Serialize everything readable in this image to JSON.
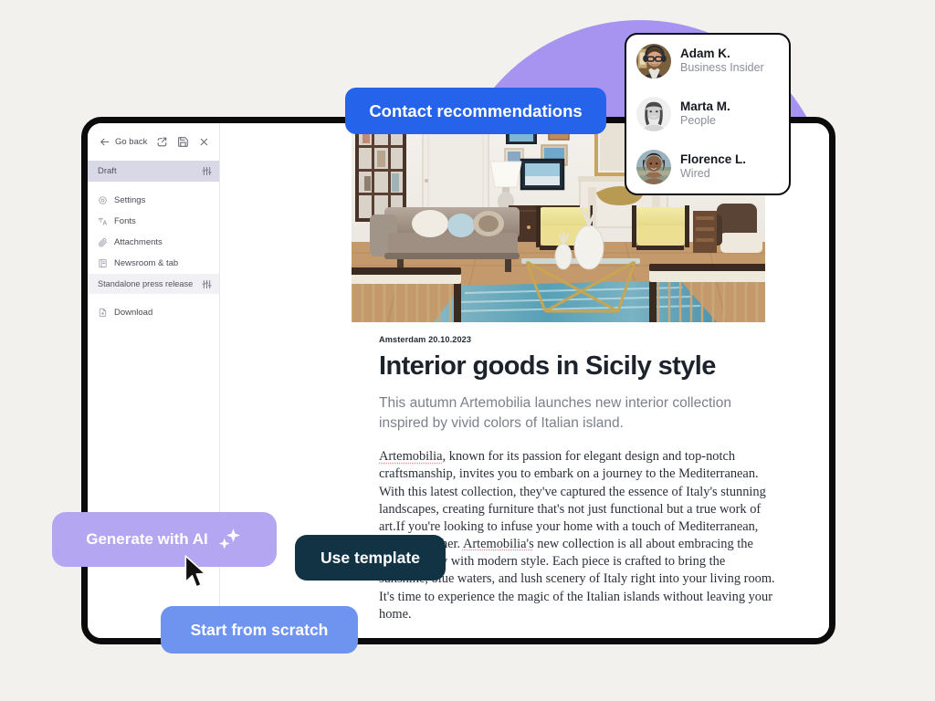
{
  "canvas": {
    "background": "#f2f1ed",
    "blob_color": "#a794f0"
  },
  "editor": {
    "toolbar": {
      "back_label": "Go back",
      "icons": [
        "arrow-left-icon",
        "external-link-icon",
        "save-icon",
        "close-icon"
      ]
    },
    "sidebar": {
      "items": [
        {
          "label": "Draft",
          "icon": "none",
          "trailing_icon": "sliders-icon",
          "state": "active"
        },
        {
          "label": "Settings",
          "icon": "gear-icon",
          "trailing_icon": "",
          "state": "default"
        },
        {
          "label": "Fonts",
          "icon": "font-icon",
          "trailing_icon": "",
          "state": "default"
        },
        {
          "label": "Attachments",
          "icon": "paperclip-icon",
          "trailing_icon": "",
          "state": "default"
        },
        {
          "label": "Newsroom & tab",
          "icon": "newsroom-icon",
          "trailing_icon": "",
          "state": "default"
        },
        {
          "label": "Standalone press release",
          "icon": "none",
          "trailing_icon": "sliders-icon",
          "state": "highlighted"
        },
        {
          "label": "Download",
          "icon": "download-file-icon",
          "trailing_icon": "",
          "state": "default"
        }
      ]
    },
    "article": {
      "dateline": "Amsterdam 20.10.2023",
      "headline": "Interior goods in Sicily style",
      "standfirst": "This autumn Artemobilia launches new interior collection inspired by vivid colors of Italian island.",
      "body_lead": "Artemobilia",
      "body_rest": ", known for its passion for elegant design and top-notch craftsmanship, invites you to embark on a journey to the Mediterranean. With this latest collection, they've captured the essence of Italy's stunning landscapes, creating furniture that's not just functional but a true work of art.If you're looking to infuse your home with a touch of Mediterranean, look no further. ",
      "body_brand2": "Artemobilia's",
      "body_tail": " new collection is all about embracing the spirit of Italy with modern style. Each piece is crafted to bring the sunshine, blue waters, and lush scenery of Italy right into your living room. It's time to experience the magic of the Italian islands without leaving your home.",
      "hero_alt": "living-room-interior-photo"
    }
  },
  "labels": {
    "contact_recommendations": "Contact recommendations",
    "generate_with_ai": "Generate with AI",
    "use_template": "Use template",
    "start_from_scratch": "Start from scratch",
    "colors": {
      "contact": "#2563eb",
      "generate": "#b5a6f2",
      "template": "#113344",
      "scratch": "#6f94ef"
    }
  },
  "contacts": {
    "people": [
      {
        "name": "Adam K.",
        "org": "Business Insider",
        "avatar": "avatar-adam"
      },
      {
        "name": "Marta M.",
        "org": "People",
        "avatar": "avatar-marta"
      },
      {
        "name": "Florence L.",
        "org": "Wired",
        "avatar": "avatar-florence"
      }
    ]
  }
}
